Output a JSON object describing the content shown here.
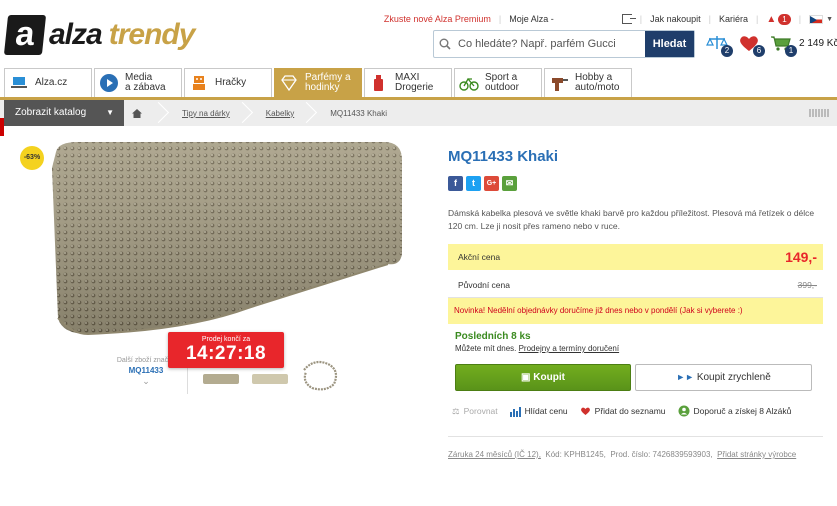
{
  "brand": {
    "logo_letter": "a",
    "name_part1": "alza",
    "name_part2": "trendy"
  },
  "top_links": {
    "premium": "Zkuste nové Alza Premium",
    "account": "Moje Alza -",
    "shopping": "Jak nakoupit",
    "career": "Kariéra",
    "notifications_count": "1"
  },
  "search": {
    "placeholder": "Co hledáte? Např. parfém Gucci",
    "button": "Hledat"
  },
  "header_icons": {
    "compare_count": "2",
    "favorites_count": "6",
    "cart_count": "1",
    "cart_total": "2 149 Kč"
  },
  "categories": [
    {
      "label": "Alza.cz"
    },
    {
      "label": "Media\na zábava"
    },
    {
      "label": "Hračky"
    },
    {
      "label": "Parfémy a\nhodinky"
    },
    {
      "label": "MAXI\nDrogerie"
    },
    {
      "label": "Sport a\noutdoor"
    },
    {
      "label": "Hobby a\nauto/moto"
    }
  ],
  "catalog_button": "Zobrazit katalog",
  "breadcrumb": [
    "Tipy na dárky",
    "Kabelky",
    "MQ11433 Khaki"
  ],
  "gallery": {
    "discount_badge": "-63%",
    "more_goods_label": "Další zboží značky",
    "more_goods_code": "MQ11433",
    "countdown_label": "Prodej končí za",
    "countdown_time": "14:27:18"
  },
  "product": {
    "title": "MQ11433 Khaki",
    "description": "Dámská kabelka plesová ve světle khaki barvě pro každou příležitost. Plesová má řetízek o délce 120 cm. Lze ji nosit přes rameno nebo v ruce.",
    "action_price_label": "Akční cena",
    "action_price": "149,-",
    "original_price_label": "Původní cena",
    "original_price": "399,-",
    "notice": "Novinka! Nedělní objednávky doručíme již dnes nebo v pondělí (Jak si vyberete :)",
    "stock_title": "Posledních 8 ks",
    "stock_text": "Můžete mít dnes.",
    "stock_link": "Prodejny a termíny doručení",
    "buy_button": "Koupit",
    "fast_buy_button": "Koupit zrychleně"
  },
  "actions": {
    "compare": "Porovnat",
    "watch_price": "Hlídat cenu",
    "add_to_list": "Přidat do seznamu",
    "recommend": "Doporuč a získej 8 Alzáků"
  },
  "meta": {
    "warranty": "Záruka 24 měsíců (IČ 12),",
    "code": "Kód: KPHB1245,",
    "prod_number": "Prod. číslo: 7426839593903,",
    "maker_link": "Přidat stránky výrobce"
  },
  "colors": {
    "gold": "#c8a247",
    "blue": "#2a6fb5",
    "red": "#e8262b",
    "green": "#5a931a",
    "yellow": "#fdf59a"
  }
}
